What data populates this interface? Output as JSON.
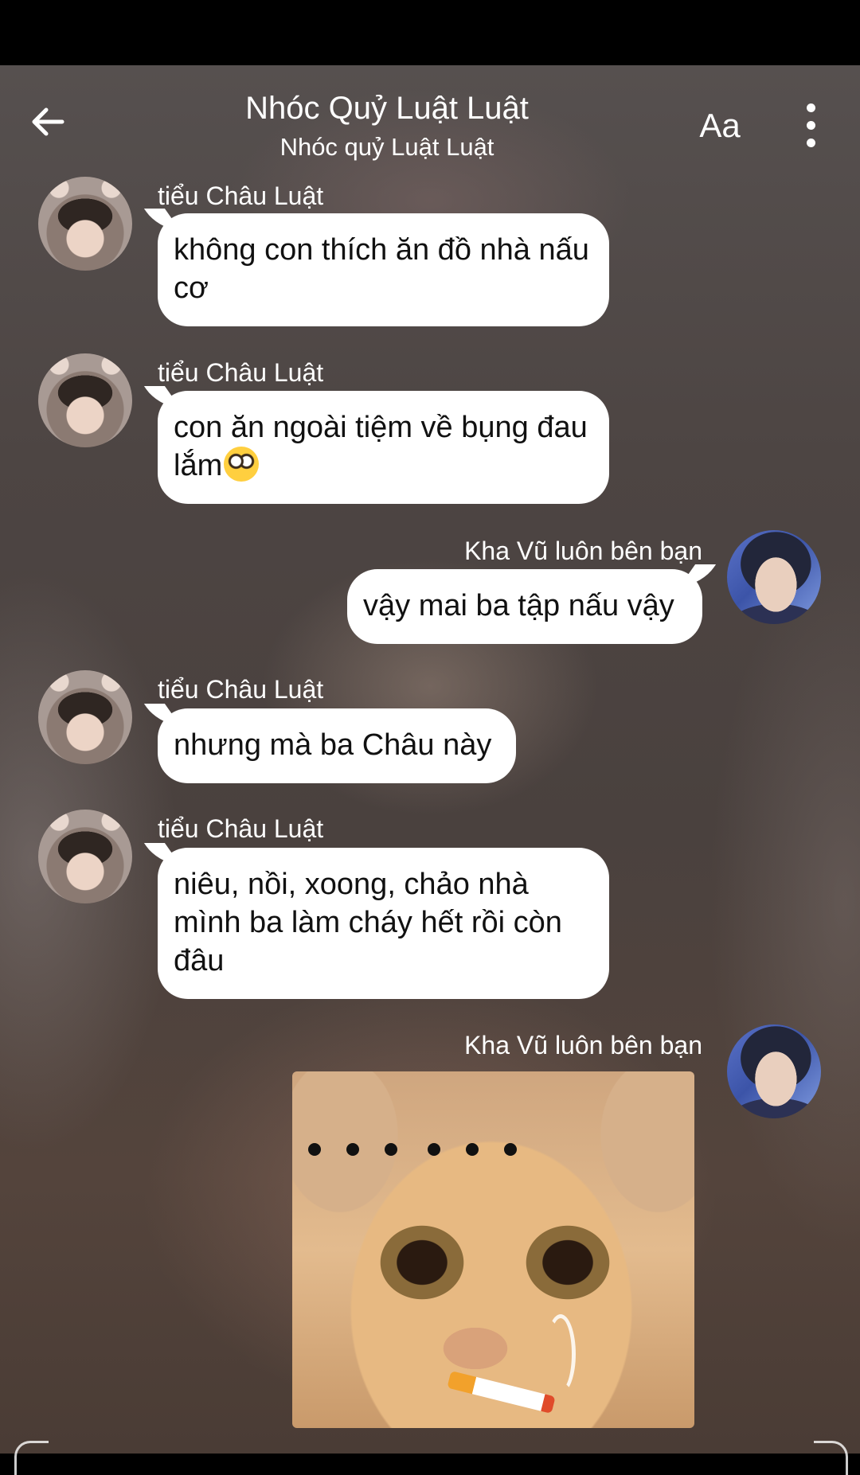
{
  "header": {
    "title": "Nhóc Quỷ Luật Luật",
    "subtitle": "Nhóc quỷ Luật Luật",
    "font_button_label": "Aa"
  },
  "messages": [
    {
      "sender": "tiểu Châu Luật",
      "direction": "in",
      "text": "không con thích ăn đồ nhà nấu cơ"
    },
    {
      "sender": "tiểu Châu Luật",
      "direction": "in",
      "text": "con ăn ngoài tiệm về bụng đau lắm"
    },
    {
      "sender": "Kha Vũ luôn bên bạn",
      "direction": "out",
      "text": "vậy mai ba tập nấu vậy"
    },
    {
      "sender": "tiểu Châu Luật",
      "direction": "in",
      "text": "nhưng mà ba Châu này"
    },
    {
      "sender": "tiểu Châu Luật",
      "direction": "in",
      "text": "niêu, nồi, xoong, chảo nhà mình ba làm cháy hết rồi còn đâu"
    },
    {
      "sender": "Kha Vũ luôn bên bạn",
      "direction": "out",
      "text": "",
      "sticker": "cat-smoking-sticker"
    }
  ],
  "colors": {
    "bubble": "#ffffff",
    "header_text": "#ffffff",
    "status_bar": "#000000"
  },
  "icons": {
    "back": "arrow-left-icon",
    "more": "more-vertical-icon",
    "emoji": "pleading-face-emoji"
  }
}
